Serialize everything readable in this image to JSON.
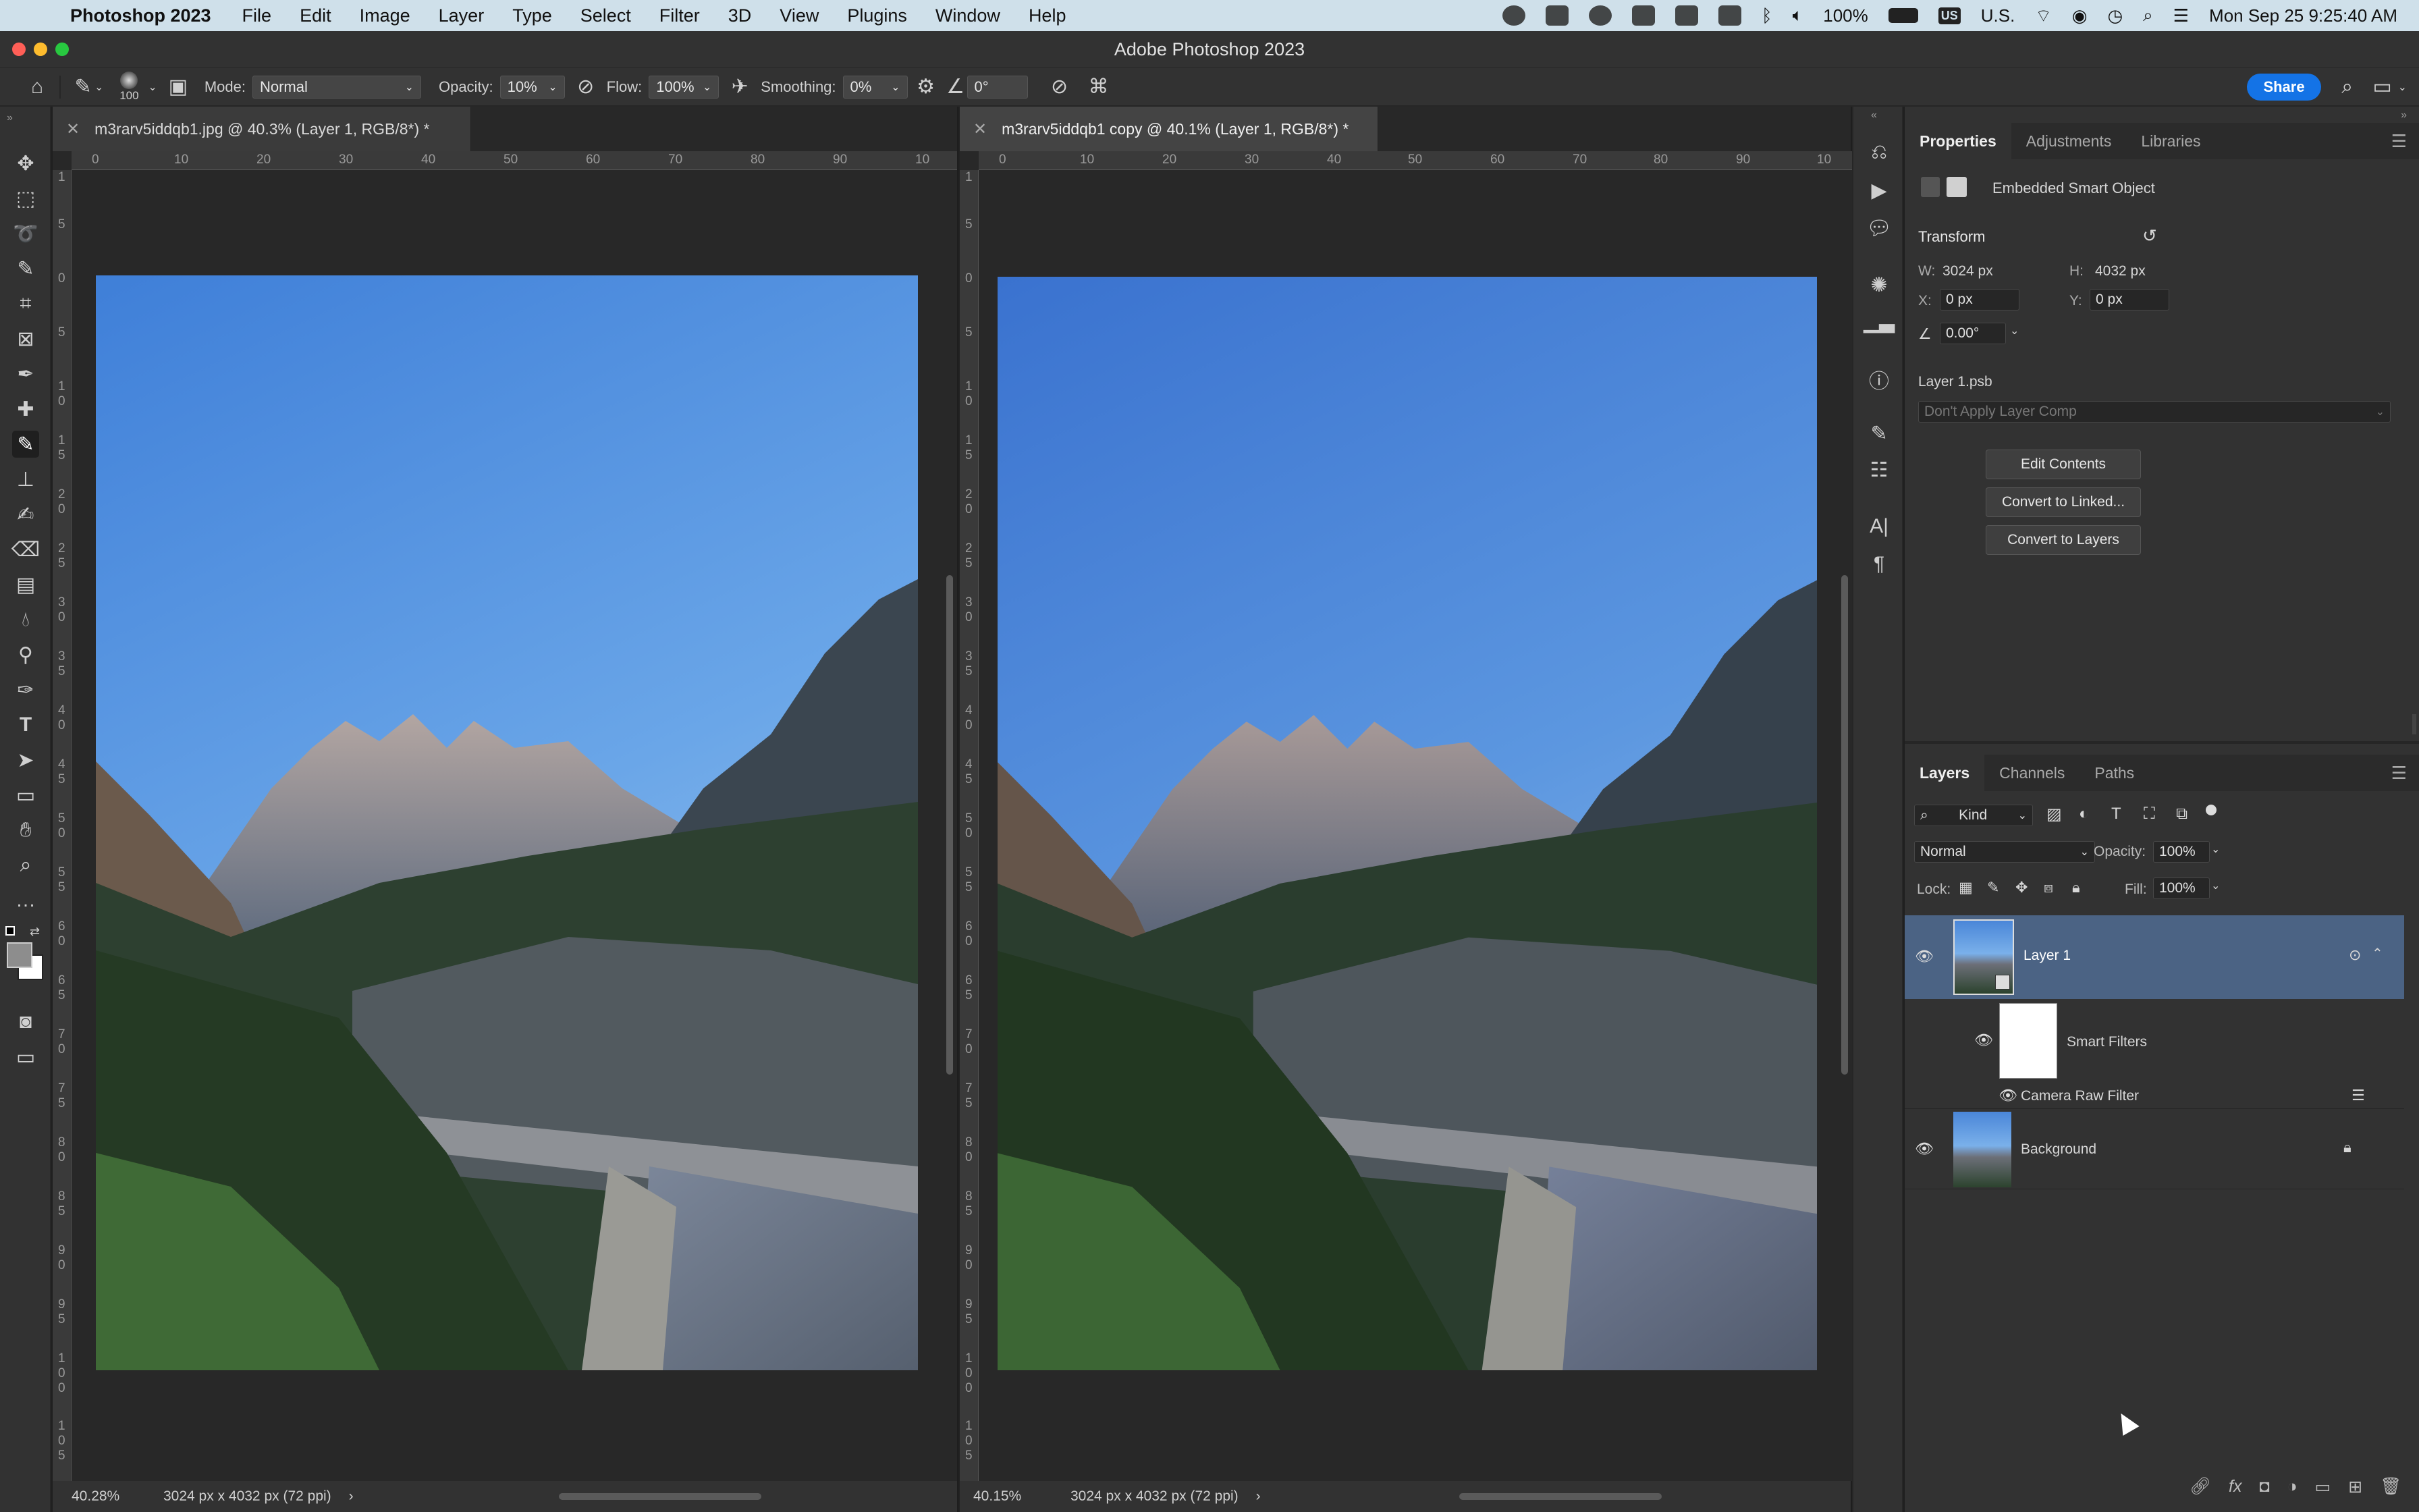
{
  "menubar": {
    "app_name": "Photoshop 2023",
    "items": [
      "File",
      "Edit",
      "Image",
      "Layer",
      "Type",
      "Select",
      "Filter",
      "3D",
      "View",
      "Plugins",
      "Window",
      "Help"
    ],
    "battery": "100%",
    "input_source": "U.S.",
    "input_badge": "US",
    "clock": "Mon Sep 25  9:25:40 AM"
  },
  "window": {
    "title": "Adobe Photoshop 2023"
  },
  "options_bar": {
    "brush_size": "100",
    "mode_label": "Mode:",
    "mode_value": "Normal",
    "opacity_label": "Opacity:",
    "opacity_value": "10%",
    "flow_label": "Flow:",
    "flow_value": "100%",
    "smoothing_label": "Smoothing:",
    "smoothing_value": "0%",
    "angle_value": "0°",
    "share_label": "Share"
  },
  "documents": [
    {
      "tab_title": "m3rarv5iddqb1.jpg @ 40.3% (Layer 1, RGB/8*) *",
      "zoom": "40.28%",
      "info": "3024 px x 4032 px (72 ppi)",
      "ruler_h": [
        "0",
        "10",
        "20",
        "30",
        "40",
        "50",
        "60",
        "70",
        "80",
        "90",
        "10"
      ],
      "ruler_v": [
        "1",
        "5",
        "0",
        "5",
        "1 0",
        "1 5",
        "2 0",
        "2 5",
        "3 0",
        "3 5",
        "4 0",
        "4 5",
        "5 0",
        "5 5",
        "6 0",
        "6 5",
        "7 0",
        "7 5",
        "8 0",
        "8 5",
        "9 0",
        "9 5",
        "1 0 0",
        "1 0 5"
      ]
    },
    {
      "tab_title": "m3rarv5iddqb1 copy @ 40.1% (Layer 1, RGB/8*) *",
      "zoom": "40.15%",
      "info": "3024 px x 4032 px (72 ppi)",
      "ruler_h": [
        "0",
        "10",
        "20",
        "30",
        "40",
        "50",
        "60",
        "70",
        "80",
        "90",
        "10"
      ],
      "ruler_v": [
        "1",
        "5",
        "0",
        "5",
        "1 0",
        "1 5",
        "2 0",
        "2 5",
        "3 0",
        "3 5",
        "4 0",
        "4 5",
        "5 0",
        "5 5",
        "6 0",
        "6 5",
        "7 0",
        "7 5",
        "8 0",
        "8 5",
        "9 0",
        "9 5",
        "1 0 0",
        "1 0 5"
      ]
    }
  ],
  "properties": {
    "tabs": [
      "Properties",
      "Adjustments",
      "Libraries"
    ],
    "kind": "Embedded Smart Object",
    "transform_label": "Transform",
    "w_label": "W:",
    "w_value": "3024 px",
    "h_label": "H:",
    "h_value": "4032 px",
    "x_label": "X:",
    "x_value": "0 px",
    "y_label": "Y:",
    "y_value": "0 px",
    "angle_value": "0.00°",
    "file_name": "Layer 1.psb",
    "layer_comp": "Don't Apply Layer Comp",
    "buttons": [
      "Edit Contents",
      "Convert to Linked...",
      "Convert to Layers"
    ]
  },
  "layers_panel": {
    "tabs": [
      "Layers",
      "Channels",
      "Paths"
    ],
    "filter_kind": "Kind",
    "blend_mode": "Normal",
    "opacity_label": "Opacity:",
    "opacity_value": "100%",
    "lock_label": "Lock:",
    "fill_label": "Fill:",
    "fill_value": "100%",
    "layers": [
      {
        "name": "Layer 1",
        "selected": true
      },
      {
        "name": "Smart Filters"
      },
      {
        "name": "Camera Raw Filter"
      },
      {
        "name": "Background"
      }
    ]
  },
  "colors": {
    "accent": "#1473e6",
    "panel_bg": "#323232",
    "selected_layer": "#4b6384"
  }
}
